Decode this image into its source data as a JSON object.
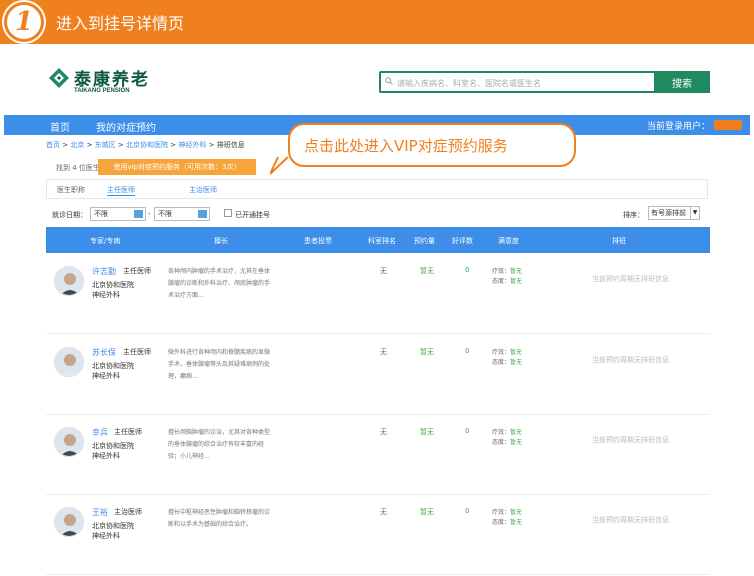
{
  "banner": {
    "step": "1",
    "title": "进入到挂号详情页"
  },
  "brand": {
    "name_cn": "泰康养老",
    "name_en": "TAIKANG PENSION"
  },
  "search": {
    "placeholder": "请输入疾病名、科室名、医院名或医生名",
    "button": "搜索"
  },
  "nav": {
    "items": [
      "首页",
      "我的对症预约"
    ],
    "user_label": "当前登录用户："
  },
  "breadcrumb": [
    "首页",
    "北京",
    "东城区",
    "北京协和医院",
    "神经外科",
    "排班信息"
  ],
  "callout": {
    "text": "点击此处进入VIP对症预约服务"
  },
  "result": {
    "count_text": "找到 4 位医生",
    "vip_button": "使用vip对症预约服务（可用次数：3次）"
  },
  "filter": {
    "label": "医生职称",
    "tabs": [
      "主任医师",
      "主治医师"
    ]
  },
  "date_filter": {
    "label": "就诊日期：",
    "from": "不限",
    "to": "不限",
    "checkbox_label": "已开通挂号",
    "sort_label": "排序：",
    "sort_value": "有号源排前"
  },
  "table": {
    "headers": [
      "专家/专病",
      "擅长",
      "患者投票",
      "科室排名",
      "预约量",
      "好评数",
      "满意度",
      "排班"
    ],
    "rows": [
      {
        "name": "许志勤",
        "title": "主任医师",
        "hospital": "北京协和医院",
        "dept": "神经外科",
        "desc": "各种颅内肿瘤的手术治疗，尤其在垂体腺瘤的诊断和外科治疗、颅底肿瘤的手术治疗方面...",
        "rank": "无",
        "bookings": "暂无",
        "likes": "0",
        "sat_effect": "暂无",
        "sat_attitude": "暂无",
        "schedule": "当前预约周期无排班信息"
      },
      {
        "name": "苏长保",
        "title": "主任医师",
        "hospital": "北京协和医院",
        "dept": "神经外科",
        "desc": "微外科进行各种颅内和脊髓疾病的显微手术，垂体腺瘤等头及其疑难病例的处理，癫痫...",
        "rank": "无",
        "bookings": "暂无",
        "likes": "0",
        "sat_effect": "暂无",
        "sat_attitude": "暂无",
        "schedule": "当前预约周期无排班信息"
      },
      {
        "name": "幸兵",
        "title": "主任医师",
        "hospital": "北京协和医院",
        "dept": "神经外科",
        "desc": "擅长颅脑肿瘤的诊治，尤其对各种类型的垂体腺瘤的综合治疗有较丰富的经验；小儿神经...",
        "rank": "无",
        "bookings": "暂无",
        "likes": "0",
        "sat_effect": "暂无",
        "sat_attitude": "暂无",
        "schedule": "当前预约周期无排班信息"
      },
      {
        "name": "王裕",
        "title": "主治医师",
        "hospital": "北京协和医院",
        "dept": "神经外科",
        "desc": "擅长中枢神经恶性肿瘤和脑转移瘤的诊断和以手术为基础的综合治疗。",
        "rank": "无",
        "bookings": "暂无",
        "likes": "0",
        "sat_effect": "暂无",
        "sat_attitude": "暂无",
        "schedule": "当前预约周期无排班信息"
      }
    ]
  },
  "labels": {
    "effect": "疗效：",
    "attitude": "态度：",
    "breadcrumb_sep": ">"
  },
  "colors": {
    "accent": "#f0801e",
    "nav": "#3c8ee8",
    "brand": "#1f8a5f"
  }
}
